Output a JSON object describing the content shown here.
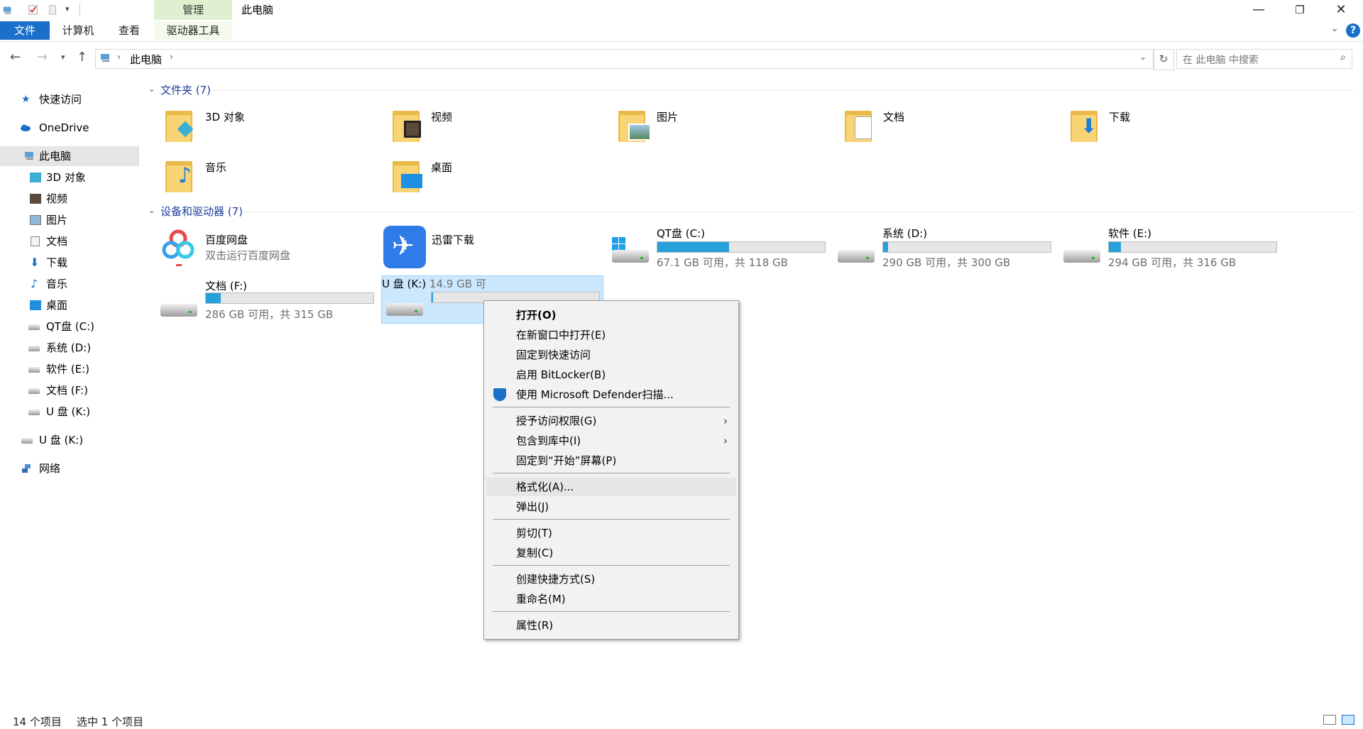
{
  "titlebar": {
    "manage_tab": "管理",
    "window_title": "此电脑",
    "minimize_glyph": "—",
    "maximize_glyph": "❐",
    "close_glyph": "✕"
  },
  "ribbon": {
    "tab_file": "文件",
    "tab_computer": "计算机",
    "tab_view": "查看",
    "tab_drive_tools": "驱动器工具",
    "help": "?"
  },
  "address": {
    "path": "此电脑",
    "search_placeholder": "在 此电脑 中搜索"
  },
  "navpane": {
    "quick_access": "快速访问",
    "onedrive": "OneDrive",
    "this_pc": "此电脑",
    "items": [
      "3D 对象",
      "视频",
      "图片",
      "文档",
      "下载",
      "音乐",
      "桌面",
      "QT盘 (C:)",
      "系统 (D:)",
      "软件 (E:)",
      "文档 (F:)",
      "U 盘 (K:)"
    ],
    "usb": "U 盘 (K:)",
    "network": "网络"
  },
  "folders": {
    "header": "文件夹 (7)",
    "items": [
      "3D 对象",
      "视频",
      "图片",
      "文档",
      "下载",
      "音乐",
      "桌面"
    ]
  },
  "devices": {
    "header": "设备和驱动器 (7)",
    "baidu": {
      "name": "百度网盘",
      "sub": "双击运行百度网盘"
    },
    "xunlei": {
      "name": "迅雷下载"
    },
    "drives": [
      {
        "name": "QT盘 (C:)",
        "info": "67.1 GB 可用，共 118 GB",
        "used": 0.43
      },
      {
        "name": "系统 (D:)",
        "info": "290 GB 可用，共 300 GB",
        "used": 0.03
      },
      {
        "name": "软件 (E:)",
        "info": "294 GB 可用，共 316 GB",
        "used": 0.07
      },
      {
        "name": "文档 (F:)",
        "info": "286 GB 可用，共 315 GB",
        "used": 0.09
      },
      {
        "name": "U 盘 (K:)",
        "info": "14.9 GB 可",
        "used": 0.01
      }
    ]
  },
  "context_menu": {
    "items": [
      "打开(O)",
      "在新窗口中打开(E)",
      "固定到快速访问",
      "启用 BitLocker(B)",
      "使用 Microsoft Defender扫描...",
      "授予访问权限(G)",
      "包含到库中(I)",
      "固定到“开始”屏幕(P)",
      "格式化(A)...",
      "弹出(J)",
      "剪切(T)",
      "复制(C)",
      "创建快捷方式(S)",
      "重命名(M)",
      "属性(R)"
    ]
  },
  "status": {
    "count": "14 个项目",
    "selected": "选中 1 个项目"
  },
  "colors": {
    "accent": "#1a6fc9",
    "selection": "#cce8ff",
    "bar_fill": "#26a0da",
    "group_header": "#1e3e9c"
  }
}
